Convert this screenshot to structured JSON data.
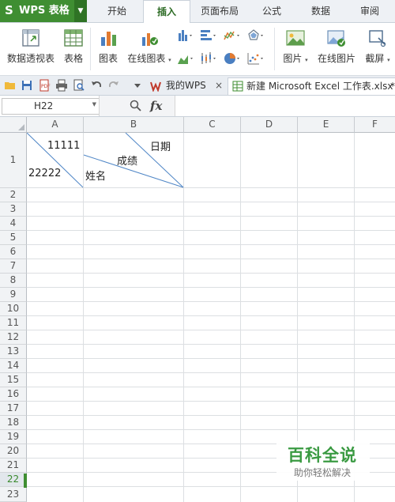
{
  "app": {
    "logo": "S",
    "title": "WPS 表格"
  },
  "menu": {
    "tabs": [
      "开始",
      "插入",
      "页面布局",
      "公式",
      "数据",
      "审阅"
    ],
    "active_index": 1
  },
  "ribbon": {
    "buttons": [
      "数据透视表",
      "表格",
      "图表",
      "在线图表",
      "图片",
      "在线图片",
      "截屏"
    ],
    "dropdown_suffix": "▾"
  },
  "doc_tabs": {
    "wps": "我的WPS",
    "excel": "新建 Microsoft Excel 工作表.xlsx",
    "close_glyph": "×",
    "more_glyph": "*"
  },
  "formula_bar": {
    "cell_ref": "H22",
    "fx": "fx",
    "content": ""
  },
  "grid": {
    "columns": [
      "A",
      "B",
      "C",
      "D",
      "E",
      "F"
    ],
    "rows": [
      "1",
      "2",
      "3",
      "4",
      "5",
      "6",
      "7",
      "8",
      "9",
      "10",
      "11",
      "12",
      "13",
      "14",
      "15",
      "16",
      "17",
      "18",
      "19",
      "20",
      "21",
      "22",
      "23"
    ],
    "selected_row": "22",
    "cells": {
      "a1_top": "11111",
      "a1_bottom": "22222",
      "b1_top": "日期",
      "b1_middle": "成绩",
      "b1_bottom": "姓名"
    }
  },
  "watermark": {
    "title": "百科全说",
    "subtitle": "助你轻松解决"
  },
  "colors": {
    "brand_green": "#3f8e32",
    "diagonal_line": "#4f86c6",
    "watermark_green": "#3a9a42"
  }
}
